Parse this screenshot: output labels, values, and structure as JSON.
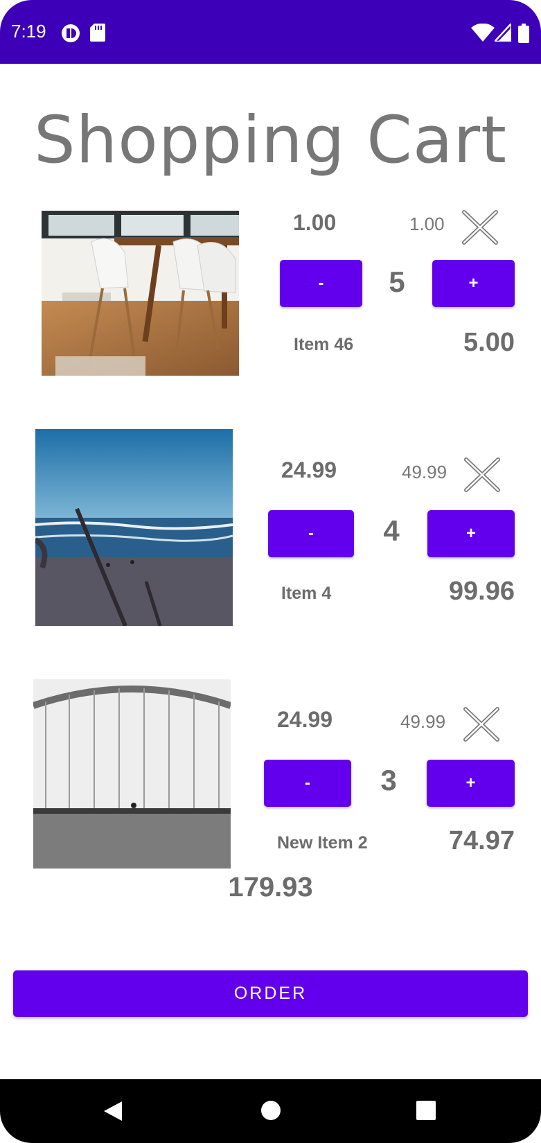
{
  "status": {
    "time": "7:19"
  },
  "title": "Shopping Cart",
  "items": [
    {
      "price": "1.00",
      "original_price": "1.00",
      "quantity": "5",
      "name": "Item 46",
      "subtotal": "5.00",
      "minus": "-",
      "plus": "+",
      "image": "dining-room"
    },
    {
      "price": "24.99",
      "original_price": "49.99",
      "quantity": "4",
      "name": "Item 4",
      "subtotal": "99.96",
      "minus": "-",
      "plus": "+",
      "image": "beach"
    },
    {
      "price": "24.99",
      "original_price": "49.99",
      "quantity": "3",
      "name": "New Item 2",
      "subtotal": "74.97",
      "minus": "-",
      "plus": "+",
      "image": "bridge"
    }
  ],
  "total": "179.93",
  "order_button": "ORDER",
  "colors": {
    "status_bar": "#3d00b8",
    "accent": "#6200ee",
    "text": "#6c6c6c"
  }
}
